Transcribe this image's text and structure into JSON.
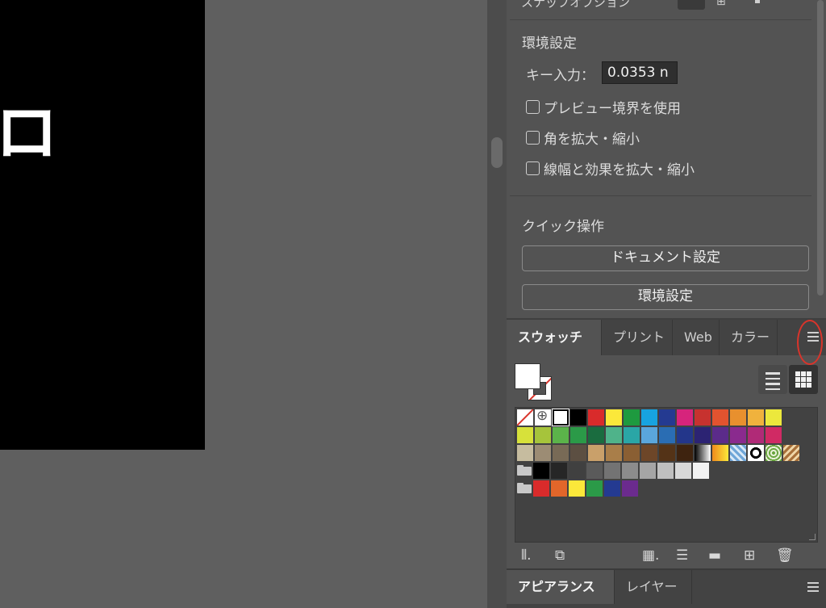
{
  "canvas": {
    "artboard_text": "ロ"
  },
  "properties": {
    "top_label": "スナップオプション",
    "top_value": "1",
    "preferences": {
      "title": "環境設定",
      "key_label": "キー入力：",
      "key_value": "0.0353 n",
      "checkboxes": [
        {
          "label": "プレビュー境界を使用",
          "checked": false
        },
        {
          "label": "角を拡大・縮小",
          "checked": false
        },
        {
          "label": "線幅と効果を拡大・縮小",
          "checked": false
        }
      ]
    },
    "quick_actions": {
      "title": "クイック操作",
      "buttons": [
        "ドキュメント設定",
        "環境設定"
      ]
    }
  },
  "swatches_panel": {
    "tabs": [
      "スウォッチ",
      "プリント",
      "Web",
      "カラー"
    ],
    "active_tab": "スウォッチ",
    "fill_color": "#ffffff",
    "stroke": "none",
    "view_modes": [
      "list-view",
      "grid-view"
    ],
    "active_view": "grid-view",
    "rows": [
      [
        "none",
        "registration",
        "white",
        "#000000",
        "#d92b2b",
        "#fbe83a",
        "#1e9a3f",
        "#17a3e0",
        "#243a91",
        "#d6247c",
        "#c7322f",
        "#e2532f",
        "#e8902e",
        "#f0b23d",
        "#ece83c"
      ],
      [
        "#d7e13a",
        "#a6c43b",
        "#5bb34a",
        "#2b9a48",
        "#1a6c3f",
        "#4fb38a",
        "#2aa6a6",
        "#5aa6dc",
        "#2a6db3",
        "#23368a",
        "#2c2373",
        "#5b2b8a",
        "#8a2a8e",
        "#b02a77",
        "#d02a64"
      ],
      [
        "#c6bc9f",
        "#9c8c74",
        "#786a56",
        "#5c4f42",
        "#c9a06a",
        "#a97e49",
        "#8a5f33",
        "#6d4628",
        "#543317",
        "#3e230f",
        "grad-bw",
        "grad-ye",
        "pattern-blue",
        "pattern-dots",
        "pattern-green",
        "pattern-brown"
      ],
      [
        "folder",
        "#000000",
        "#262626",
        "#404040",
        "#5a5a5a",
        "#737373",
        "#8c8c8c",
        "#a5a5a5",
        "#bfbfbf",
        "#d8d8d8",
        "#f2f2f2"
      ],
      [
        "folder",
        "#d92b2b",
        "#e2662a",
        "#fbe83a",
        "#2b9a48",
        "#243a91",
        "#6b2b8e"
      ]
    ],
    "bottom_tools": [
      "library-icon",
      "place-swatch-icon",
      "swatch-kind-icon",
      "swatch-options-icon",
      "new-group-icon",
      "new-swatch-icon",
      "delete-icon"
    ]
  },
  "appearance_panel": {
    "tabs": [
      "アピアランス",
      "レイヤー"
    ]
  },
  "colors": {
    "panel_bg": "#535353",
    "tab_bg": "#434343",
    "highlight_circle": "#d9342b"
  }
}
